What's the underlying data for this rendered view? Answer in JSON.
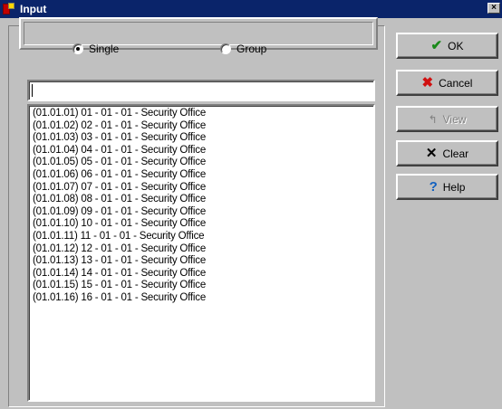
{
  "window": {
    "title": "Input",
    "close_glyph": "×"
  },
  "mode": {
    "options": [
      {
        "label": "Single",
        "selected": true
      },
      {
        "label": "Group",
        "selected": false
      }
    ]
  },
  "search": {
    "value": "",
    "placeholder": ""
  },
  "list": {
    "items": [
      "(01.01.01) 01 - 01 - 01 - Security Office",
      "(01.01.02) 02 - 01 - 01 - Security Office",
      "(01.01.03) 03 - 01 - 01 - Security Office",
      "(01.01.04) 04 - 01 - 01 - Security Office",
      "(01.01.05) 05 - 01 - 01 - Security Office",
      "(01.01.06) 06 - 01 - 01 - Security Office",
      "(01.01.07) 07 - 01 - 01 - Security Office",
      "(01.01.08) 08 - 01 - 01 - Security Office",
      "(01.01.09) 09 - 01 - 01 - Security Office",
      "(01.01.10) 10 - 01 - 01 - Security Office",
      "(01.01.11) 11 - 01 - 01 - Security Office",
      "(01.01.12) 12 - 01 - 01 - Security Office",
      "(01.01.13) 13 - 01 - 01 - Security Office",
      "(01.01.14) 14 - 01 - 01 - Security Office",
      "(01.01.15) 15 - 01 - 01 - Security Office",
      "(01.01.16) 16 - 01 - 01 - Security Office"
    ]
  },
  "buttons": {
    "ok": {
      "label": "OK",
      "icon": "checkmark-icon",
      "glyph": "✔",
      "color": "#1a8a1a"
    },
    "cancel": {
      "label": "Cancel",
      "icon": "red-x-icon",
      "glyph": "✖",
      "color": "#d01010"
    },
    "view": {
      "label": "View",
      "icon": "view-arrow-icon",
      "glyph": "↰",
      "enabled": false
    },
    "clear": {
      "label": "Clear",
      "icon": "x-icon",
      "glyph": "✕",
      "color": "#000000"
    },
    "help": {
      "label": "Help",
      "icon": "question-mark-icon",
      "glyph": "?",
      "color": "#1060c0"
    }
  },
  "colors": {
    "titlebar": "#0a246a",
    "face": "#c0c0c0"
  }
}
